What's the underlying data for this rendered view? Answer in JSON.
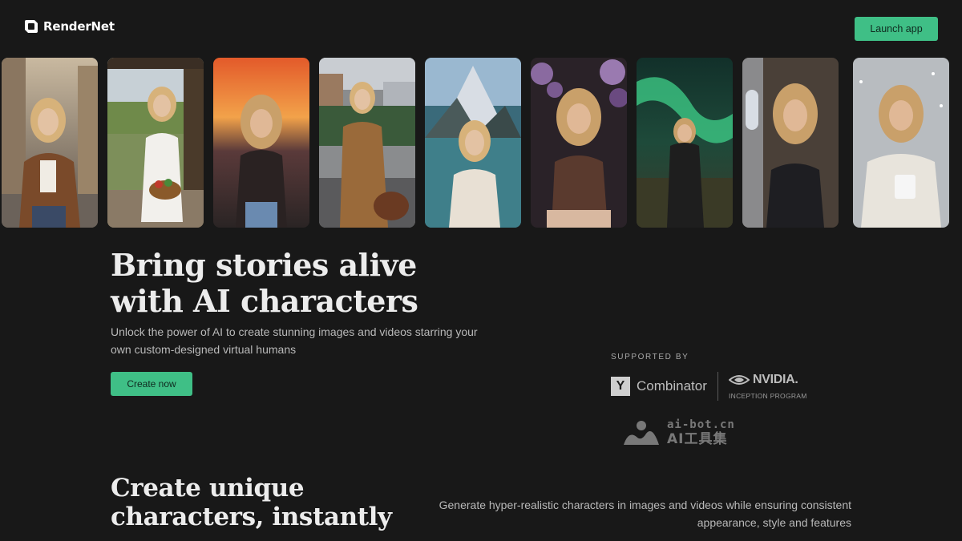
{
  "header": {
    "brand": "RenderNet",
    "launch_label": "Launch app"
  },
  "gallery": {
    "cards": [
      {
        "scene": "city-street-jacket-coffee"
      },
      {
        "scene": "porch-white-dress-basket"
      },
      {
        "scene": "sunset-tank-top"
      },
      {
        "scene": "tram-street-trench-coat"
      },
      {
        "scene": "mountain-lake-cardigan"
      },
      {
        "scene": "flowers-brown-top"
      },
      {
        "scene": "aurora-black-coat"
      },
      {
        "scene": "airplane-window-blazer"
      },
      {
        "scene": "snow-sweater-mug"
      }
    ]
  },
  "hero": {
    "title_line1": "Bring stories alive",
    "title_line2": "with AI characters",
    "subtitle": "Unlock the power of AI to create stunning images and videos starring your own custom-designed virtual humans",
    "cta_label": "Create now"
  },
  "supporters": {
    "label": "SUPPORTED BY",
    "yc_letter": "Y",
    "yc_name": "Combinator",
    "nvidia_name": "NVIDIA.",
    "nvidia_program": "INCEPTION PROGRAM"
  },
  "watermark": {
    "url": "ai-bot.cn",
    "name": "AI工具集"
  },
  "section2": {
    "title_line1": "Create unique",
    "title_line2": "characters, instantly",
    "description": "Generate hyper-realistic characters in images and videos while ensuring consistent appearance, style and features"
  },
  "colors": {
    "background": "#181818",
    "accent": "#3fbf86",
    "heading": "#ececec",
    "body_text": "#b9b9b9"
  }
}
